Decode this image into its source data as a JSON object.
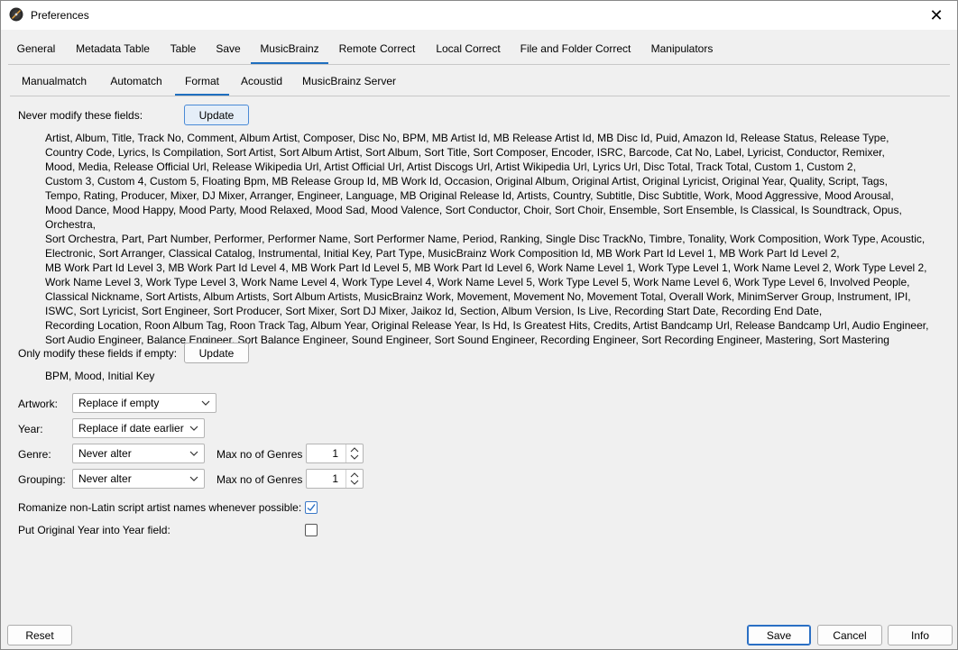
{
  "window": {
    "title": "Preferences",
    "close_glyph": "✕",
    "app_icon": "app-logo-icon"
  },
  "main_tabs": [
    {
      "label": "General"
    },
    {
      "label": "Metadata Table"
    },
    {
      "label": "Table"
    },
    {
      "label": "Save"
    },
    {
      "label": "MusicBrainz",
      "active": true
    },
    {
      "label": "Remote Correct"
    },
    {
      "label": "Local Correct"
    },
    {
      "label": "File and Folder Correct"
    },
    {
      "label": "Manipulators"
    }
  ],
  "sub_tabs": [
    {
      "label": "Manualmatch"
    },
    {
      "label": "Automatch"
    },
    {
      "label": "Format",
      "active": true
    },
    {
      "label": "Acoustid"
    },
    {
      "label": "MusicBrainz Server"
    }
  ],
  "never_modify": {
    "label": "Never modify these fields:",
    "button": "Update",
    "lines": [
      "Artist, Album, Title, Track No, Comment, Album Artist, Composer, Disc No, BPM, MB Artist Id, MB Release Artist Id, MB Disc Id, Puid, Amazon Id, Release Status, Release Type,",
      "Country Code, Lyrics, Is Compilation, Sort Artist, Sort Album Artist, Sort Album, Sort Title, Sort Composer, Encoder, ISRC, Barcode, Cat No, Label, Lyricist, Conductor, Remixer,",
      "Mood, Media, Release Official Url, Release Wikipedia Url, Artist Official Url, Artist Discogs Url, Artist Wikipedia Url, Lyrics Url, Disc Total, Track Total, Custom 1, Custom 2,",
      "Custom 3, Custom 4, Custom 5, Floating Bpm, MB Release Group Id, MB Work Id, Occasion, Original Album, Original Artist, Original Lyricist, Original Year, Quality, Script, Tags,",
      "Tempo, Rating, Producer, Mixer, DJ Mixer, Arranger, Engineer, Language, MB Original Release Id, Artists, Country, Subtitle, Disc Subtitle, Work, Mood Aggressive, Mood Arousal,",
      "Mood Dance, Mood Happy, Mood Party, Mood Relaxed, Mood Sad, Mood Valence, Sort Conductor, Choir, Sort Choir, Ensemble, Sort Ensemble, Is Classical, Is Soundtrack, Opus, Orchestra,",
      "Sort Orchestra, Part, Part Number, Performer, Performer Name, Sort Performer Name, Period, Ranking, Single Disc TrackNo, Timbre, Tonality, Work Composition, Work Type, Acoustic,",
      "Electronic, Sort Arranger, Classical Catalog, Instrumental, Initial Key, Part Type, MusicBrainz Work Composition Id, MB Work Part Id Level 1, MB Work Part Id Level 2,",
      "MB Work Part Id Level 3, MB Work Part Id Level 4, MB Work Part Id Level 5, MB Work Part Id Level 6, Work Name Level 1, Work Type Level 1, Work Name Level 2, Work Type Level 2,",
      "Work Name Level 3, Work Type Level 3, Work Name Level 4, Work Type Level 4, Work Name Level 5, Work Type Level 5, Work Name Level 6, Work Type Level 6, Involved People,",
      "Classical Nickname, Sort Artists, Album Artists, Sort Album Artists, MusicBrainz Work, Movement, Movement No, Movement Total, Overall Work, MinimServer Group, Instrument, IPI,",
      "ISWC, Sort Lyricist, Sort Engineer, Sort Producer, Sort Mixer, Sort DJ Mixer, Jaikoz Id, Section, Album Version, Is Live, Recording Start Date, Recording End Date,",
      "Recording Location, Roon Album Tag, Roon Track Tag, Album Year, Original Release Year, Is Hd, Is Greatest Hits, Credits, Artist Bandcamp Url, Release Bandcamp Url, Audio Engineer,",
      "Sort Audio Engineer, Balance Engineer, Sort Balance Engineer, Sound Engineer, Sort Sound Engineer, Recording Engineer, Sort Recording Engineer, Mastering, Sort Mastering"
    ]
  },
  "only_if_empty": {
    "label": "Only modify these fields if empty:",
    "button": "Update",
    "fields": "BPM, Mood, Initial Key"
  },
  "artwork": {
    "label": "Artwork:",
    "value": "Replace if empty"
  },
  "year": {
    "label": "Year:",
    "value": "Replace if date earlier"
  },
  "genre": {
    "label": "Genre:",
    "value": "Never alter",
    "max_label": "Max no of Genres",
    "max_value": "1"
  },
  "grouping": {
    "label": "Grouping:",
    "value": "Never alter",
    "max_label": "Max no of Genres",
    "max_value": "1"
  },
  "romanize": {
    "label": "Romanize non-Latin script artist names whenever possible:",
    "checked": true
  },
  "original_year": {
    "label": "Put Original Year into Year field:",
    "checked": false
  },
  "footer": {
    "reset": "Reset",
    "save": "Save",
    "cancel": "Cancel",
    "info": "Info"
  },
  "colors": {
    "accent": "#1f6fbf",
    "background": "#f0f0f0"
  }
}
